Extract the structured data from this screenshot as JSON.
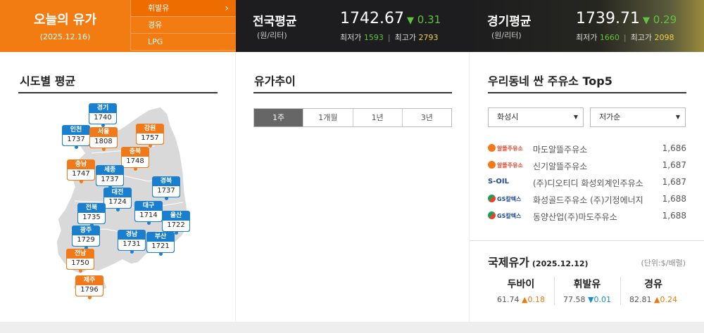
{
  "header": {
    "today_title": "오늘의 유가",
    "today_date": "(2025.12.16)",
    "fuel_tabs": [
      "휘발유",
      "경유",
      "LPG"
    ],
    "national": {
      "name": "전국평균",
      "unit": "(원/리터)",
      "price": "1742.67",
      "change": "0.31",
      "min_label": "최저가",
      "min": "1593",
      "max_label": "최고가",
      "max": "2793"
    },
    "gyeonggi": {
      "name": "경기평균",
      "unit": "(원/리터)",
      "price": "1739.71",
      "change": "0.29",
      "min_label": "최저가",
      "min": "1660",
      "max_label": "최고가",
      "max": "2098"
    }
  },
  "regional": {
    "title": "시도별 평균",
    "regions": [
      {
        "name": "경기",
        "value": "1740",
        "color": "blue"
      },
      {
        "name": "인천",
        "value": "1737",
        "color": "blue"
      },
      {
        "name": "서울",
        "value": "1808",
        "color": "orange"
      },
      {
        "name": "강원",
        "value": "1757",
        "color": "orange"
      },
      {
        "name": "충북",
        "value": "1748",
        "color": "orange"
      },
      {
        "name": "충남",
        "value": "1747",
        "color": "orange"
      },
      {
        "name": "세종",
        "value": "1737",
        "color": "blue"
      },
      {
        "name": "경북",
        "value": "1737",
        "color": "blue"
      },
      {
        "name": "대전",
        "value": "1724",
        "color": "blue"
      },
      {
        "name": "전북",
        "value": "1735",
        "color": "blue"
      },
      {
        "name": "대구",
        "value": "1714",
        "color": "blue"
      },
      {
        "name": "울산",
        "value": "1722",
        "color": "blue"
      },
      {
        "name": "광주",
        "value": "1729",
        "color": "blue"
      },
      {
        "name": "경남",
        "value": "1731",
        "color": "blue"
      },
      {
        "name": "부산",
        "value": "1721",
        "color": "blue"
      },
      {
        "name": "전남",
        "value": "1750",
        "color": "orange"
      },
      {
        "name": "제주",
        "value": "1796",
        "color": "orange"
      }
    ]
  },
  "trend": {
    "title": "유가추이",
    "tabs": [
      "1주",
      "1개월",
      "1년",
      "3년"
    ],
    "active_tab": "1주"
  },
  "top5": {
    "title": "우리동네 싼 주유소 Top5",
    "city": "화성시",
    "sort": "저가순",
    "stations": [
      {
        "brand": "알뜰주유소",
        "name": "마도알뜰주유소",
        "price": "1,686"
      },
      {
        "brand": "알뜰주유소",
        "name": "신기알뜰주유소",
        "price": "1,687"
      },
      {
        "brand": "S-OIL",
        "name": "(주)디오티디 화성외계인주유소",
        "price": "1,687"
      },
      {
        "brand": "GS칼텍스",
        "name": "화성골드주유소 (주)기정에너지",
        "price": "1,688"
      },
      {
        "brand": "GS칼텍스",
        "name": "동양산업(주)마도주유소",
        "price": "1,688"
      }
    ]
  },
  "intl": {
    "title": "국제유가",
    "date": "(2025.12.12)",
    "unit": "(단위:$/배럴)",
    "items": [
      {
        "name": "두바이",
        "price": "61.74",
        "change": "0.18",
        "dir": "up"
      },
      {
        "name": "휘발유",
        "price": "77.58",
        "change": "0.01",
        "dir": "down"
      },
      {
        "name": "경유",
        "price": "82.81",
        "change": "0.24",
        "dir": "up"
      }
    ]
  },
  "colors": {
    "accent": "#f27c11",
    "blue": "#1b7fcf",
    "down_green": "#5ec43d"
  }
}
